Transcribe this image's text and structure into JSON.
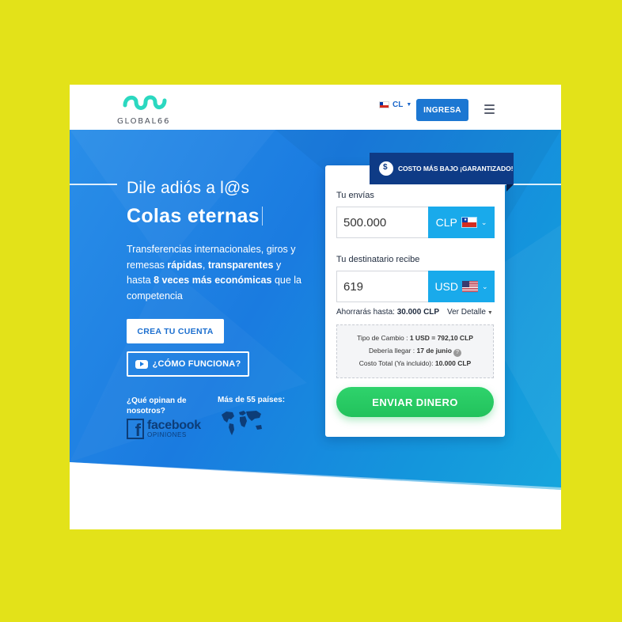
{
  "header": {
    "logo_text": "GLOBAL66",
    "lang_code": "CL",
    "login_label": "INGRESA",
    "menu_icon": "hamburger-menu-icon"
  },
  "hero": {
    "headline_light": "Dile adiós a l@s",
    "headline_bold": "Colas eternas",
    "subtext": {
      "p1": "Transferencias internacionales, giros y remesas ",
      "b1": "rápidas",
      "p2": ", ",
      "b2": "transparentes",
      "p3": " y hasta ",
      "b3": "8 veces más económicas",
      "p4": " que la competencia"
    },
    "create_account_label": "CREA TU CUENTA",
    "how_it_works_label": "¿CÓMO FUNCIONA?",
    "opinions_question": "¿Qué opinan de nosotros?",
    "facebook_name": "facebook",
    "facebook_sub": "OPINIONES",
    "countries_label": "Más de 55 países:"
  },
  "calculator": {
    "ribbon_text": "COSTO MÁS BAJO ¡GARANTIZADO!",
    "send_label": "Tu envías",
    "send_amount": "500.000",
    "send_currency": "CLP",
    "receive_label": "Tu destinatario recibe",
    "receive_amount": "619",
    "receive_currency": "USD",
    "savings_label": "Ahorrarás hasta:",
    "savings_value": "30.000 CLP",
    "details_toggle": "Ver Detalle",
    "rate_label": "Tipo de Cambio : ",
    "rate_value": "1 USD = 792,10 CLP",
    "arrival_label": "Debería llegar : ",
    "arrival_value": "17 de junio",
    "cost_label": "Costo Total (Ya incluido): ",
    "cost_value": "10.000 CLP",
    "submit_label": "ENVIAR DINERO"
  },
  "colors": {
    "page_background": "#e3e219",
    "brand_blue": "#1c77d2",
    "currency_select": "#19aaeb",
    "ribbon": "#0e3b86",
    "cta_green": "#22c25c",
    "logo_teal": "#2bd8c0"
  }
}
